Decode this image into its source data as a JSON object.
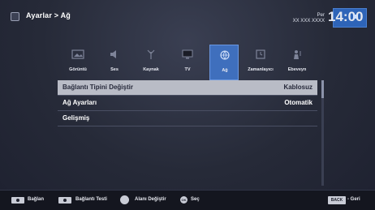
{
  "header": {
    "breadcrumb": "Ayarlar > Ağ",
    "day": "Per",
    "date": "XX XXX XXXX",
    "time": "14:00"
  },
  "categories": [
    {
      "label": "Görüntü",
      "icon": "picture-icon"
    },
    {
      "label": "Ses",
      "icon": "speaker-icon"
    },
    {
      "label": "Kaynak",
      "icon": "antenna-icon"
    },
    {
      "label": "TV",
      "icon": "tv-icon"
    },
    {
      "label": "Ağ",
      "icon": "network-globe-icon"
    },
    {
      "label": "Zamanlayıcı",
      "icon": "timer-icon"
    },
    {
      "label": "Ebeveyn",
      "icon": "parental-icon"
    }
  ],
  "active_category": "Ağ",
  "menu": {
    "rows": [
      {
        "label": "Bağlantı Tipini Değiştir",
        "value": "Kablosuz"
      },
      {
        "label": "Ağ Ayarları",
        "value": "Otomatik"
      },
      {
        "label": "Gelişmiş",
        "value": ""
      }
    ]
  },
  "footer": {
    "connect": "Bağlan",
    "connection_test": "Bağlantı Testi",
    "change_area": "Alanı Değiştir",
    "select": "Seç",
    "back_key": "BACK",
    "back": "Geri"
  },
  "colors": {
    "accent": "#3f6fbd",
    "selected_row": "#b9bcc6",
    "background": "#2b2f3e"
  }
}
